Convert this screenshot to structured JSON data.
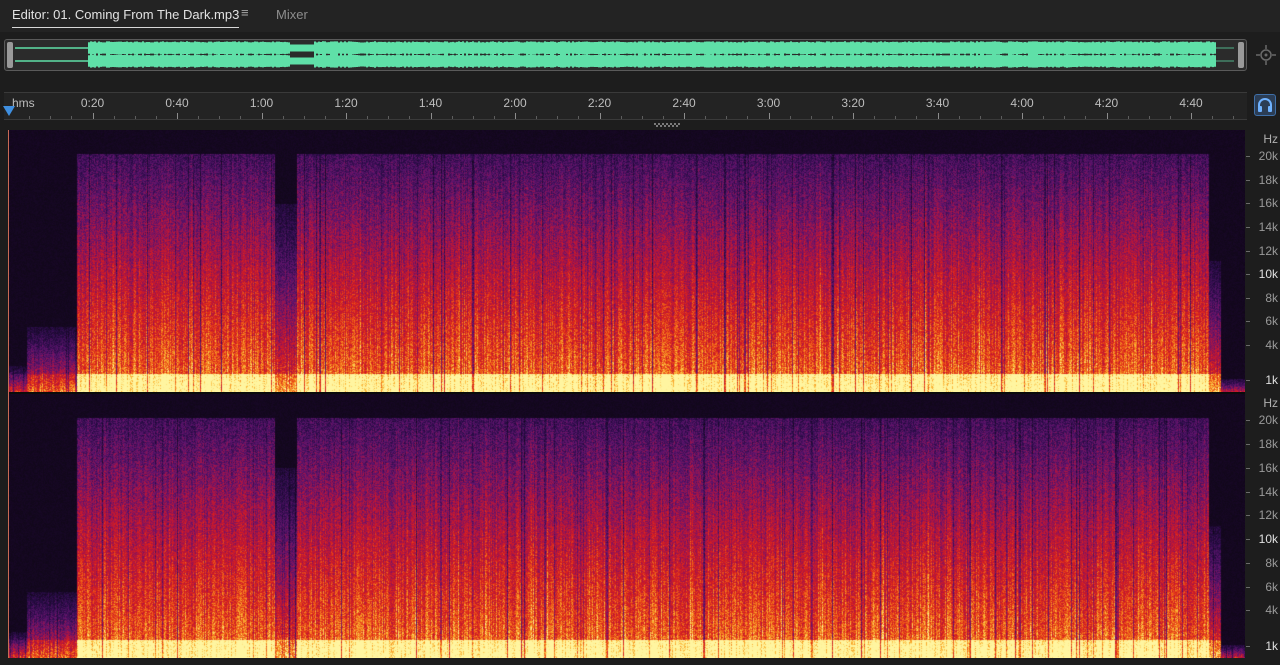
{
  "tabs": {
    "editor_label": "Editor: 01. Coming From The Dark.mp3",
    "menu_glyph": "≡",
    "mixer_label": "Mixer"
  },
  "ruler": {
    "unit": "hms",
    "ticks": [
      "0:20",
      "0:40",
      "1:00",
      "1:20",
      "1:40",
      "2:00",
      "2:20",
      "2:40",
      "3:00",
      "3:20",
      "3:40",
      "4:00",
      "4:20",
      "4:40"
    ]
  },
  "channels": [
    {
      "freq_labels": [
        "Hz",
        "20k",
        "18k",
        "16k",
        "14k",
        "12k",
        "10k",
        "8k",
        "6k",
        "4k",
        "1k"
      ]
    },
    {
      "freq_labels": [
        "Hz",
        "20k",
        "18k",
        "16k",
        "14k",
        "12k",
        "10k",
        "8k",
        "6k",
        "4k",
        "1k"
      ]
    }
  ],
  "icons": {
    "zoom": "zoom-navigator-icon",
    "monitor": "headphones-monitor-icon",
    "playhead": "playhead-marker-icon"
  },
  "colors": {
    "waveform": "#5fe0a8",
    "playhead": "#3f8fe0",
    "spectrum_low": "#1a0a2a",
    "spectrum_mid": "#c0192a",
    "spectrum_high": "#ffe060"
  }
}
